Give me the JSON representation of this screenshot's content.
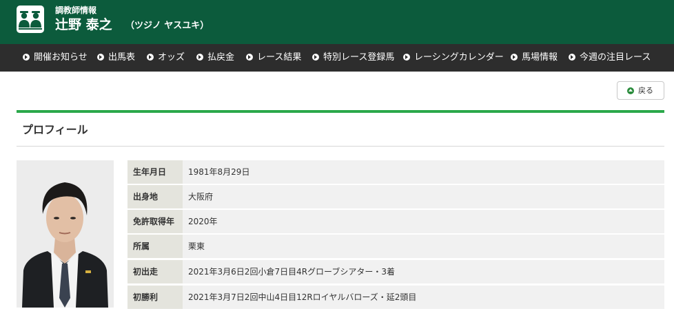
{
  "header": {
    "subtitle": "調教師情報",
    "name": "辻野 泰之",
    "kana": "（ツジノ ヤスユキ）",
    "logo_icon": "trainer-logo-icon",
    "background_color": "#0c5b3c"
  },
  "nav": {
    "items": [
      {
        "label": "開催お知らせ",
        "icon": "circle-arrow-right-icon"
      },
      {
        "label": "出馬表",
        "icon": "circle-arrow-right-icon"
      },
      {
        "label": "オッズ",
        "icon": "circle-arrow-right-icon"
      },
      {
        "label": "払戻金",
        "icon": "circle-arrow-right-icon"
      },
      {
        "label": "レース結果",
        "icon": "circle-arrow-right-icon"
      },
      {
        "label": "特別レース登録馬",
        "icon": "circle-arrow-right-icon"
      },
      {
        "label": "レーシングカレンダー",
        "icon": "circle-arrow-right-icon"
      },
      {
        "label": "馬場情報",
        "icon": "circle-arrow-right-icon"
      },
      {
        "label": "今週の注目レース",
        "icon": "circle-arrow-right-icon"
      }
    ]
  },
  "back_button": {
    "label": "戻る",
    "icon": "circle-arrow-up-icon"
  },
  "section": {
    "title": "プロフィール",
    "accent_color": "#2aa84a"
  },
  "profile": {
    "rows": [
      {
        "label": "生年月日",
        "value": "1981年8月29日"
      },
      {
        "label": "出身地",
        "value": "大阪府"
      },
      {
        "label": "免許取得年",
        "value": "2020年"
      },
      {
        "label": "所属",
        "value": "栗東"
      },
      {
        "label": "初出走",
        "value": "2021年3月6日2回小倉7日目4Rグローブシアター・3着"
      },
      {
        "label": "初勝利",
        "value": "2021年3月7日2回中山4日目12Rロイヤルバローズ・延2頭目"
      }
    ]
  }
}
